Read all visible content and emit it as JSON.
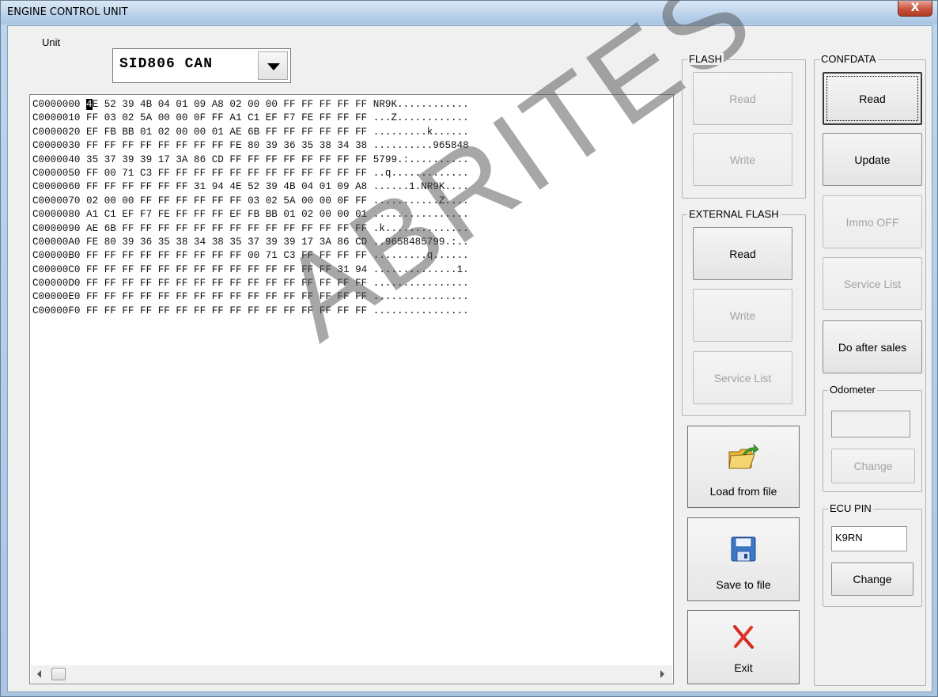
{
  "window": {
    "title": "ENGINE CONTROL UNIT",
    "close_label": "X"
  },
  "unit": {
    "label": "Unit",
    "value": "SID806 CAN"
  },
  "hex_lines": [
    "C0000000 4E 52 39 4B 04 01 09 A8 02 00 00 FF FF FF FF FF NR9K............",
    "C0000010 FF 03 02 5A 00 00 0F FF A1 C1 EF F7 FE FF FF FF ...Z............",
    "C0000020 EF FB BB 01 02 00 00 01 AE 6B FF FF FF FF FF FF .........k......",
    "C0000030 FF FF FF FF FF FF FF FF FE 80 39 36 35 38 34 38 ..........965848",
    "C0000040 35 37 39 39 17 3A 86 CD FF FF FF FF FF FF FF FF 5799.:..........",
    "C0000050 FF 00 71 C3 FF FF FF FF FF FF FF FF FF FF FF FF ..q.............",
    "C0000060 FF FF FF FF FF FF 31 94 4E 52 39 4B 04 01 09 A8 ......1.NR9K....",
    "C0000070 02 00 00 FF FF FF FF FF FF 03 02 5A 00 00 0F FF ...........Z....",
    "C0000080 A1 C1 EF F7 FE FF FF FF EF FB BB 01 02 00 00 01 ................",
    "C0000090 AE 6B FF FF FF FF FF FF FF FF FF FF FF FF FF FF .k..............",
    "C00000A0 FE 80 39 36 35 38 34 38 35 37 39 39 17 3A 86 CD ..9658485799.:..",
    "C00000B0 FF FF FF FF FF FF FF FF FF 00 71 C3 FF FF FF FF .........q......",
    "C00000C0 FF FF FF FF FF FF FF FF FF FF FF FF FF FF 31 94 ..............1.",
    "C00000D0 FF FF FF FF FF FF FF FF FF FF FF FF FF FF FF FF ................",
    "C00000E0 FF FF FF FF FF FF FF FF FF FF FF FF FF FF FF FF ................",
    "C00000F0 FF FF FF FF FF FF FF FF FF FF FF FF FF FF FF FF ................"
  ],
  "watermark": "ABRITES",
  "flash": {
    "legend": "FLASH",
    "read": "Read",
    "write": "Write"
  },
  "external_flash": {
    "legend": "EXTERNAL FLASH",
    "read": "Read",
    "write": "Write",
    "service_list": "Service List"
  },
  "confdata": {
    "legend": "CONFDATA",
    "read": "Read",
    "update": "Update",
    "immo_off": "Immo OFF",
    "service_list": "Service List",
    "do_after_sales": "Do after sales"
  },
  "odometer": {
    "legend": "Odometer",
    "value": "",
    "change": "Change"
  },
  "ecu_pin": {
    "legend": "ECU PIN",
    "value": "K9RN",
    "change": "Change"
  },
  "file_actions": {
    "load": "Load from file",
    "save": "Save to file",
    "exit": "Exit"
  },
  "icons": {
    "load": "open-folder-icon",
    "save": "floppy-disk-icon",
    "exit": "red-x-icon"
  }
}
